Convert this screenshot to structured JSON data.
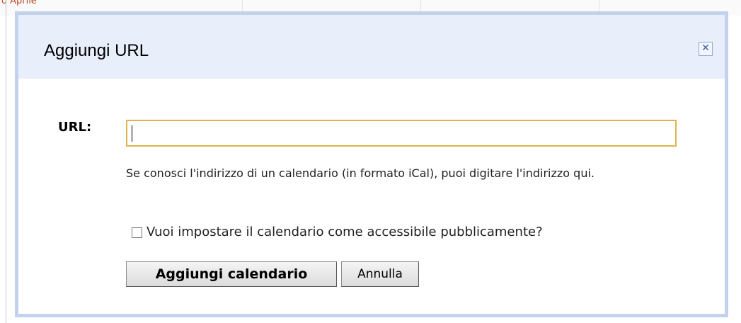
{
  "background": {
    "partial_text": "o Aprile"
  },
  "dialog": {
    "title": "Aggiungi URL",
    "close_icon": "close-icon",
    "url_label": "URL:",
    "url_input": {
      "value": "",
      "placeholder": ""
    },
    "help_text": "Se conosci l'indirizzo di un calendario (in formato iCal), puoi digitare l'indirizzo qui.",
    "public_checkbox": {
      "checked": false,
      "label": "Vuoi impostare il calendario come accessibile pubblicamente?"
    },
    "buttons": {
      "add_label": "Aggiungi calendario",
      "cancel_label": "Annulla"
    }
  },
  "colors": {
    "dialog_border": "#c3d1ec",
    "header_background": "#e8eefa",
    "input_focus_border": "#e0b34c",
    "close_icon_color": "#3b5ea6"
  }
}
